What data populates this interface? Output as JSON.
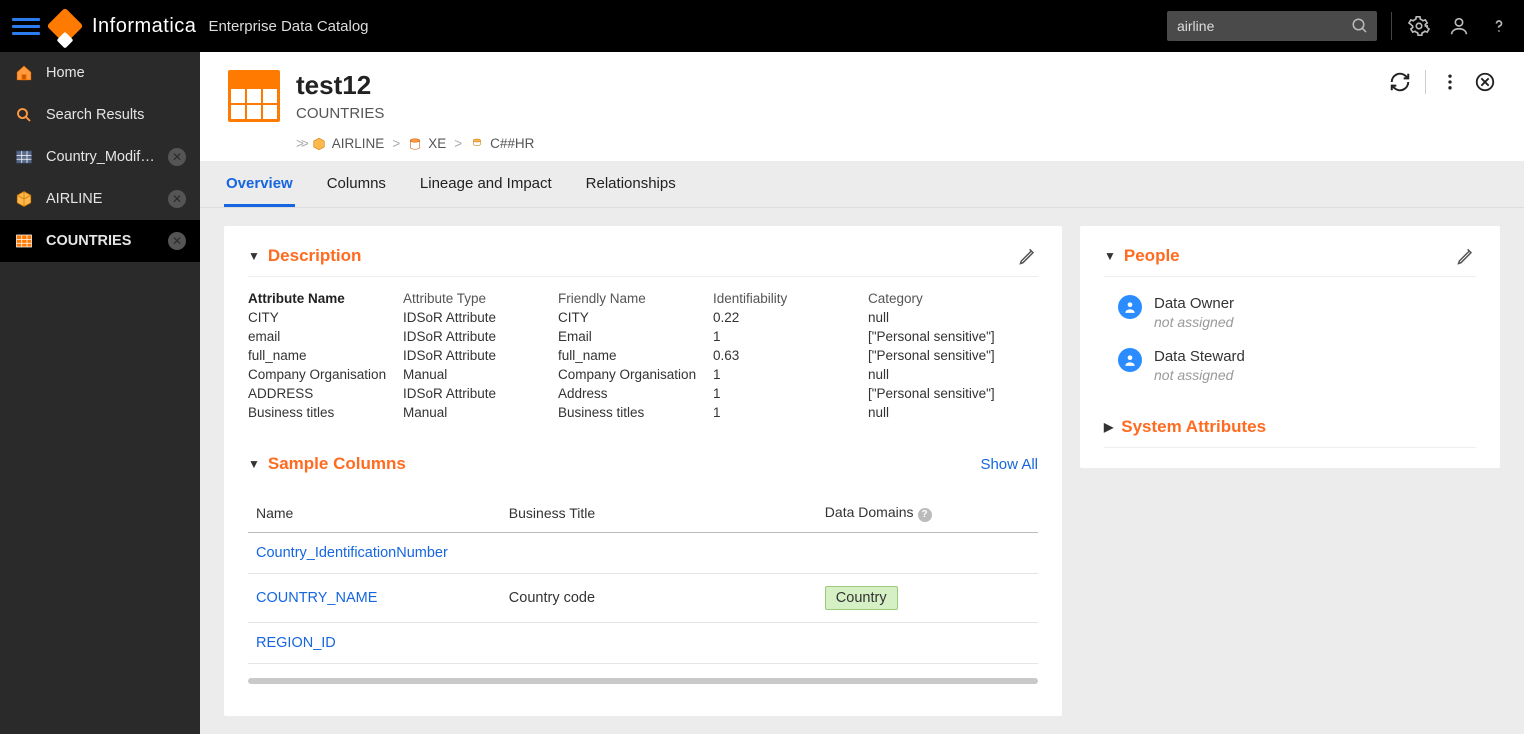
{
  "header": {
    "brand": "Informatica",
    "subbrand": "Enterprise Data Catalog",
    "search_value": "airline"
  },
  "sidebar": {
    "items": [
      {
        "label": "Home",
        "icon": "home-icon",
        "closable": false,
        "active": false
      },
      {
        "label": "Search Results",
        "icon": "search-icon",
        "closable": false,
        "active": false
      },
      {
        "label": "Country_Modified",
        "icon": "table-icon",
        "closable": true,
        "active": false
      },
      {
        "label": "AIRLINE",
        "icon": "cube-icon",
        "closable": true,
        "active": false
      },
      {
        "label": "COUNTRIES",
        "icon": "table-icon",
        "closable": true,
        "active": true
      }
    ]
  },
  "asset": {
    "title": "test12",
    "subtitle": "COUNTRIES"
  },
  "breadcrumb": [
    {
      "label": "AIRLINE"
    },
    {
      "label": "XE"
    },
    {
      "label": "C##HR"
    }
  ],
  "tabs": [
    {
      "label": "Overview",
      "active": true
    },
    {
      "label": "Columns",
      "active": false
    },
    {
      "label": "Lineage and Impact",
      "active": false
    },
    {
      "label": "Relationships",
      "active": false
    }
  ],
  "description": {
    "title": "Description",
    "headers": [
      "Attribute Name",
      "Attribute Type",
      "Friendly Name",
      "Identifiability",
      "Category"
    ],
    "rows": [
      {
        "c0": "CITY",
        "c1": "IDSoR Attribute",
        "c2": "CITY",
        "c3": "0.22",
        "c4": "null"
      },
      {
        "c0": "email",
        "c1": "IDSoR Attribute",
        "c2": "Email",
        "c3": "1",
        "c4": "[\"Personal sensitive\"]"
      },
      {
        "c0": "full_name",
        "c1": "IDSoR Attribute",
        "c2": "full_name",
        "c3": "0.63",
        "c4": "[\"Personal sensitive\"]"
      },
      {
        "c0": "Company Organisation",
        "c1": "Manual",
        "c2": "Company Organisation",
        "c3": "1",
        "c4": "null"
      },
      {
        "c0": "ADDRESS",
        "c1": "IDSoR Attribute",
        "c2": "Address",
        "c3": "1",
        "c4": "[\"Personal sensitive\"]"
      },
      {
        "c0": "Business titles",
        "c1": "Manual",
        "c2": "Business titles",
        "c3": "1",
        "c4": "null"
      }
    ]
  },
  "sample": {
    "title": "Sample Columns",
    "show_all": "Show All",
    "headers": {
      "name": "Name",
      "bt": "Business Title",
      "dd": "Data Domains"
    },
    "rows": [
      {
        "name": "Country_IdentificationNumber",
        "bt": "",
        "dd": ""
      },
      {
        "name": "COUNTRY_NAME",
        "bt": "Country code",
        "dd": "Country"
      },
      {
        "name": "REGION_ID",
        "bt": "",
        "dd": ""
      }
    ]
  },
  "people": {
    "title": "People",
    "roles": [
      {
        "role": "Data Owner",
        "value": "not assigned"
      },
      {
        "role": "Data Steward",
        "value": "not assigned"
      }
    ]
  },
  "sysattr": {
    "title": "System Attributes"
  }
}
